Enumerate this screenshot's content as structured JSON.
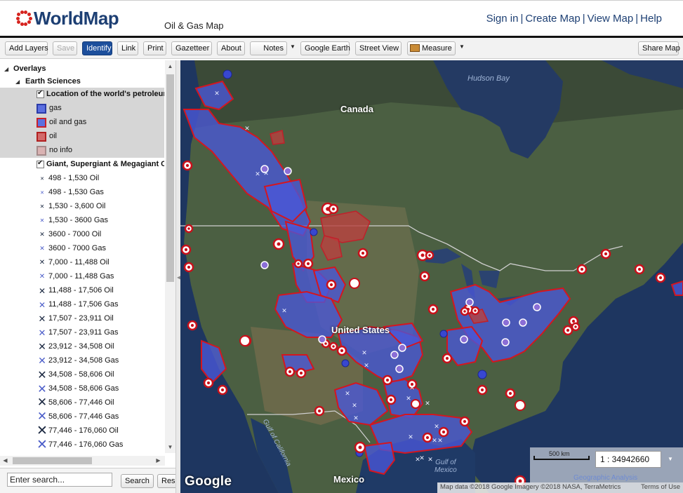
{
  "header": {
    "logo_text": "WorldMap",
    "subtitle": "Oil & Gas Map",
    "links": [
      "Sign in",
      "Create Map",
      "View Map",
      "Help"
    ]
  },
  "toolbar": {
    "add_layers": "Add Layers",
    "save": "Save",
    "identify": "Identify",
    "link": "Link",
    "print": "Print",
    "gazetteer": "Gazetteer",
    "about": "About",
    "notes": "Notes",
    "google_earth": "Google Earth",
    "street_view": "Street View",
    "measure": "Measure",
    "share_map": "Share Map"
  },
  "tree": {
    "overlays": "Overlays",
    "earth_sciences": "Earth Sciences",
    "layer1": {
      "title": "Location of the world's petroleum",
      "legend": [
        {
          "label": "gas",
          "fill": "#5b6fe0",
          "stroke": "#2b3ca8"
        },
        {
          "label": "oil and gas",
          "fill": "#5b6fe0",
          "stroke": "#c8202a"
        },
        {
          "label": "oil",
          "fill": "#d26a6a",
          "stroke": "#b12020"
        },
        {
          "label": "no info",
          "fill": "#d9b2b2",
          "stroke": "#a58a8a"
        }
      ]
    },
    "layer2": {
      "title": "Giant, Supergiant & Megagiant C",
      "legend": [
        {
          "label": "498 - 1,530 Oil",
          "kind": "oil",
          "size": 7
        },
        {
          "label": "498 - 1,530 Gas",
          "kind": "gas",
          "size": 7
        },
        {
          "label": "1,530 - 3,600 Oil",
          "kind": "oil",
          "size": 8
        },
        {
          "label": "1,530 - 3600 Gas",
          "kind": "gas",
          "size": 8
        },
        {
          "label": "3600 - 7000 Oil",
          "kind": "oil",
          "size": 9
        },
        {
          "label": "3600 - 7000 Gas",
          "kind": "gas",
          "size": 9
        },
        {
          "label": "7,000 - 11,488 Oil",
          "kind": "oil",
          "size": 10
        },
        {
          "label": "7,000 - 11,488 Gas",
          "kind": "gas",
          "size": 10
        },
        {
          "label": "11,488 - 17,506 Oil",
          "kind": "oil",
          "size": 12
        },
        {
          "label": "11,488 - 17,506 Gas",
          "kind": "gas",
          "size": 12
        },
        {
          "label": "17,507 - 23,911 Oil",
          "kind": "oil",
          "size": 13
        },
        {
          "label": "17,507 - 23,911 Gas",
          "kind": "gas",
          "size": 13
        },
        {
          "label": "23,912  -  34,508 Oil",
          "kind": "oil",
          "size": 14
        },
        {
          "label": "23,912  -  34,508 Gas",
          "kind": "gas",
          "size": 14
        },
        {
          "label": "34,508 - 58,606 Oil",
          "kind": "oil",
          "size": 16
        },
        {
          "label": "34,508 - 58,606 Gas",
          "kind": "gas",
          "size": 16
        },
        {
          "label": "58,606 - 77,446 Oil",
          "kind": "oil",
          "size": 17
        },
        {
          "label": "58,606 - 77,446 Gas",
          "kind": "gas",
          "size": 17
        },
        {
          "label": "77,446 - 176,060 Oil",
          "kind": "oil",
          "size": 19
        },
        {
          "label": "77,446 - 176,060 Gas",
          "kind": "gas",
          "size": 19
        }
      ]
    }
  },
  "search": {
    "placeholder": "Enter search...",
    "value": "Enter search...",
    "search_btn": "Search",
    "reset_btn": "Reset"
  },
  "map": {
    "labels": {
      "hudson_bay": "Hudson Bay",
      "canada": "Canada",
      "united_states": "United States",
      "mexico": "Mexico",
      "gulf_of_california": "Gulf of California",
      "gulf_of_mexico": "Gulf of\nMexico"
    },
    "scale_ratio": "1 : 34942660",
    "scale_bar_label": "500 km",
    "geo_analysis": "Geographic Analysis",
    "attribution": "Map data ©2018 Google Imagery ©2018 NASA, TerraMetrics",
    "terms": "Terms of Use",
    "google_logo": "Google"
  },
  "colors": {
    "brand_blue": "#1d3f73",
    "brand_red": "#d6231e",
    "active_button": "#1d4f9c",
    "gas_fill": "#5b6fe0",
    "oil_gas_stroke": "#c8202a",
    "oil_fill": "#d26a6a"
  }
}
